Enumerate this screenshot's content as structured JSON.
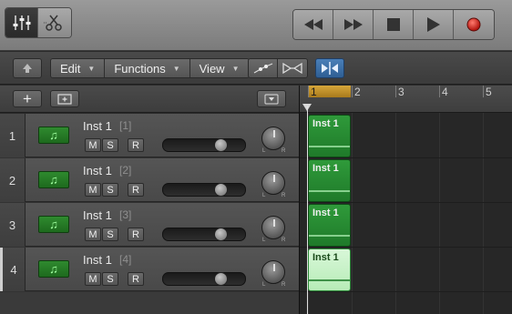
{
  "toolbar": {
    "left_tools": [
      {
        "icon": "mixer-icon",
        "active": true
      },
      {
        "icon": "scissors-icon",
        "active": false
      }
    ],
    "transport": [
      {
        "icon": "rewind-icon"
      },
      {
        "icon": "fast-forward-icon"
      },
      {
        "icon": "stop-icon"
      },
      {
        "icon": "play-icon"
      },
      {
        "icon": "record-icon",
        "color": "#d8211f"
      }
    ]
  },
  "menubar": {
    "items": [
      "Edit",
      "Functions",
      "View"
    ]
  },
  "ruler": {
    "bars": [
      "1",
      "2",
      "3",
      "4",
      "5"
    ]
  },
  "tracks": [
    {
      "number": "1",
      "name": "Inst 1",
      "index": "[1]",
      "mute": "M",
      "solo": "S",
      "record": "R",
      "volume": 0.74,
      "pan_l": "L",
      "pan_r": "R",
      "region": "Inst 1"
    },
    {
      "number": "2",
      "name": "Inst 1",
      "index": "[2]",
      "mute": "M",
      "solo": "S",
      "record": "R",
      "volume": 0.74,
      "pan_l": "L",
      "pan_r": "R",
      "region": "Inst 1"
    },
    {
      "number": "3",
      "name": "Inst 1",
      "index": "[3]",
      "mute": "M",
      "solo": "S",
      "record": "R",
      "volume": 0.74,
      "pan_l": "L",
      "pan_r": "R",
      "region": "Inst 1"
    },
    {
      "number": "4",
      "name": "Inst 1",
      "index": "[4]",
      "mute": "M",
      "solo": "S",
      "record": "R",
      "volume": 0.74,
      "pan_l": "L",
      "pan_r": "R",
      "region": "Inst 1"
    }
  ],
  "colors": {
    "region": "#2f9a3a",
    "region_selected": "#c8f2c8",
    "cycle": "#d6a63a",
    "catch": "#3a6fa8",
    "record": "#d8211f"
  }
}
